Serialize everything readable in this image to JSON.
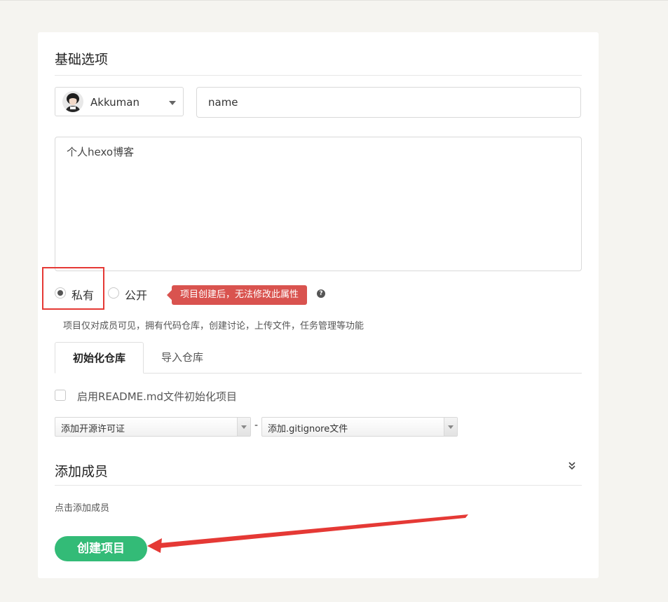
{
  "basic": {
    "section_title": "基础选项",
    "owner_name": "Akkuman",
    "name_value": "name",
    "description_value": "个人hexo博客"
  },
  "visibility": {
    "private_label": "私有",
    "public_label": "公开",
    "selected": "private",
    "tip_text": "项目创建后，无法修改此属性",
    "help_icon_glyph": "?",
    "hint": "项目仅对成员可见，拥有代码仓库，创建讨论，上传文件，任务管理等功能"
  },
  "tabs": [
    {
      "label": "初始化仓库",
      "active": true
    },
    {
      "label": "导入仓库",
      "active": false
    }
  ],
  "init": {
    "readme_label": "启用README.md文件初始化项目",
    "readme_checked": false,
    "license_select": "添加开源许可证",
    "separator": "-",
    "gitignore_select": "添加.gitignore文件"
  },
  "members": {
    "section_title": "添加成员",
    "expand_glyph": "⌄⌄",
    "hint": "点击添加成员"
  },
  "submit": {
    "label": "创建项目"
  },
  "colors": {
    "accent_green": "#33bb77",
    "tip_red": "#d9534f",
    "annotation_red": "#e53935"
  }
}
